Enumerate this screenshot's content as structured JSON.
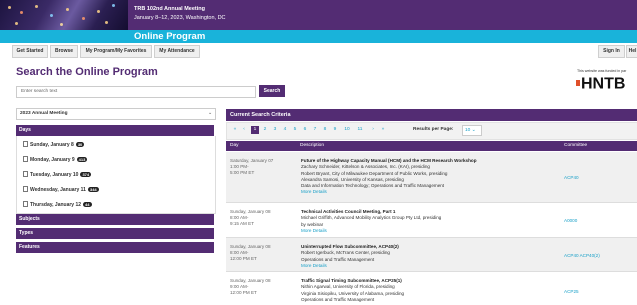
{
  "header": {
    "line1": "TRB 102nd Annual Meeting",
    "line2": "January 8–12, 2023, Washington, DC",
    "bar_title": "Online Program"
  },
  "nav": {
    "items": [
      "Get Started",
      "Browse",
      "My Program/My Favorites",
      "My Attendance"
    ],
    "sign_in": "Sign In",
    "help": "Hel"
  },
  "search": {
    "title": "Search the Online Program",
    "placeholder": "Enter search text",
    "button": "Search"
  },
  "brand": {
    "disclaimer": "This website was funded in par",
    "logo_text": "HNTB"
  },
  "meeting": {
    "selected": "2023 Annual Meeting"
  },
  "facets": {
    "days_label": "Days",
    "days": [
      {
        "label": "Sunday, January 8",
        "count": "30"
      },
      {
        "label": "Monday, January 9",
        "count": "413"
      },
      {
        "label": "Tuesday, January 10",
        "count": "374"
      },
      {
        "label": "Wednesday, January 11",
        "count": "344"
      },
      {
        "label": "Thursday, January 12",
        "count": "44"
      }
    ],
    "subjects_label": "Subjects",
    "types_label": "Types",
    "features_label": "Features"
  },
  "results": {
    "header": "Current Search Criteria",
    "pages": [
      "1",
      "2",
      "3",
      "4",
      "5",
      "6",
      "7",
      "8",
      "9",
      "10",
      "11"
    ],
    "results_per_page_label": "Results per Page:",
    "results_per_page": "10",
    "columns": {
      "day": "Day",
      "description": "Description",
      "committee": "Committee"
    },
    "rows": [
      {
        "day": "Saturday, January 07",
        "time1": "1:00 PM-",
        "time2": "5:00 PM ET",
        "title": "Future of the Highway Capacity Manual (HCM) and the HCM Research Workshop",
        "lines": [
          "Zachary Schneider, Kittelson & Associates, Inc. (KAI), presiding",
          "Robert Bryant, City of Milwaukee Department of Public Works, presiding",
          "Alexandra Samosi, University of Kansas, presiding",
          "Data and Information Technology; Operations and Traffic Management"
        ],
        "more": "More Details",
        "committee": "ACP40"
      },
      {
        "day": "Sunday, January 08",
        "time1": "8:00 AM-",
        "time2": "9:15 AM ET",
        "title": "Technical Activities Council Meeting, Part 1",
        "lines": [
          "Michael Griffith, Advanced Mobility Analytics Group Pty Ltd, presiding",
          "by webinar"
        ],
        "more": "More Details",
        "committee": "A0000"
      },
      {
        "day": "Sunday, January 08",
        "time1": "8:00 AM-",
        "time2": "12:00 PM ET",
        "title": "Uninterrupted Flow Subcommittee, ACP40(2)",
        "lines": [
          "Robert Igerbuck, McTrans Center, presiding",
          "Operations and Traffic Management"
        ],
        "more": "More Details",
        "committee": "ACP40 ACP40(2)"
      },
      {
        "day": "Sunday, January 08",
        "time1": "9:00 AM-",
        "time2": "12:00 PM ET",
        "title": "Traffic Signal Timing Subcommittee, ACP25(1)",
        "lines": [
          "Nithin Agarwal, University of Florida, presiding",
          "Virginia Sisiopiku, University of Alabama, presiding",
          "Operations and Traffic Management"
        ],
        "more": "",
        "committee": "ACP25"
      }
    ]
  },
  "colors": {
    "purple": "#532c73",
    "cyan": "#19b3da",
    "link": "#19a0c8"
  }
}
